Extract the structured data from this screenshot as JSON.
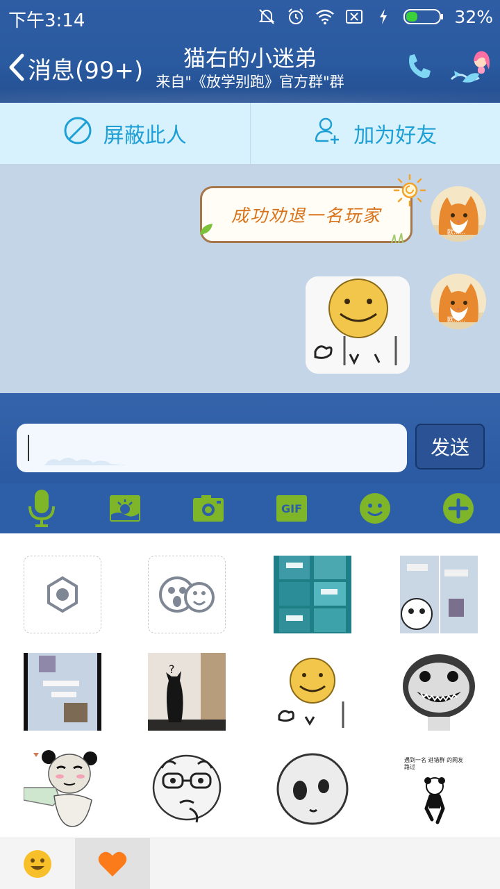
{
  "status_bar": {
    "time": "下午3:14",
    "battery_percent": "32%",
    "icons": [
      "mute-bell-icon",
      "alarm-icon",
      "wifi-icon",
      "no-sim-icon",
      "charging-icon",
      "battery-icon"
    ]
  },
  "header": {
    "back_label": "消息(99+)",
    "title": "猫右的小迷弟",
    "subtitle": "来自\"《放学别跑》官方群\"群",
    "icons": [
      "phone-icon",
      "mermaid-avatar-icon"
    ]
  },
  "actions": {
    "block_label": "屏蔽此人",
    "add_friend_label": "加为好友"
  },
  "chat": {
    "messages": [
      {
        "type": "text",
        "text": "成功劝退一名玩家",
        "avatar_caption": "欧......"
      },
      {
        "type": "sticker",
        "sticker": "smiley-meme-sticker",
        "avatar_caption": "欧......"
      }
    ]
  },
  "composer": {
    "input_value": "",
    "send_label": "发送",
    "tools": [
      "microphone-icon",
      "image-icon",
      "camera-icon",
      "gif-icon",
      "emoji-icon",
      "plus-icon"
    ],
    "gif_text": "GIF"
  },
  "stickers": {
    "items": [
      "settings-hex-icon",
      "faces-icon",
      "chat-screenshot-sticker",
      "chat-screenshot-panda-sticker",
      "chat-screenshot-sticker-2",
      "black-cat-sticker",
      "smiley-meme-sticker",
      "grinning-meme-sticker",
      "panda-meme-sticker",
      "glasses-meme-sticker",
      "round-face-meme-sticker",
      "panda-text-sticker"
    ],
    "black_cat_mark": "?",
    "panda_text": "遇到一名  进错群  的网友路过"
  },
  "bottom_tabs": {
    "items": [
      "smiley-tab-icon",
      "heart-tab-icon"
    ],
    "active": "heart-tab-icon"
  },
  "colors": {
    "header_blue": "#2f5da4",
    "action_bg": "#d7f2fc",
    "action_text": "#1ea0d6",
    "chat_bg": "#c5d5e8",
    "bubble_text": "#d8731b",
    "tool_green": "#7fb528"
  }
}
